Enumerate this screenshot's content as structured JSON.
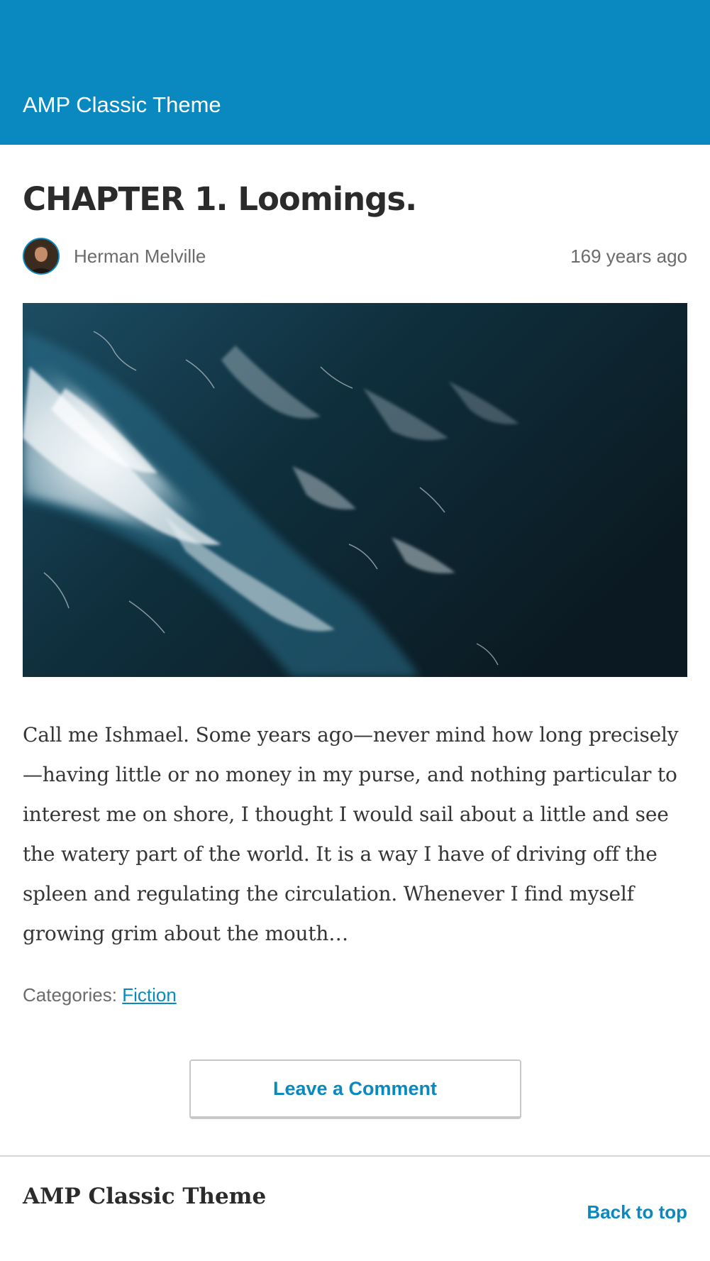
{
  "header": {
    "site_title": "AMP Classic Theme",
    "background_color": "#0a89c0"
  },
  "post": {
    "title": "CHAPTER 1. Loomings.",
    "author": "Herman Melville",
    "time": "169 years ago",
    "featured_image": "aerial view of dark ocean with white crashing waves",
    "excerpt": "Call me Ishmael. Some years ago—never mind how long precisely—having little or no money in my purse, and nothing particular to interest me on shore, I thought I would sail about a little and see the watery part of the world. It is a way I have of driving off the spleen and regulating the circulation. Whenever I find myself growing grim about the mouth…",
    "categories_label": "Categories:",
    "category": "Fiction"
  },
  "actions": {
    "comment_label": "Leave a Comment"
  },
  "footer": {
    "site_title": "AMP Classic Theme",
    "back_to_top": "Back to top"
  },
  "colors": {
    "accent": "#0a89c0",
    "text": "#353535",
    "meta_text": "#6b6b6b"
  }
}
